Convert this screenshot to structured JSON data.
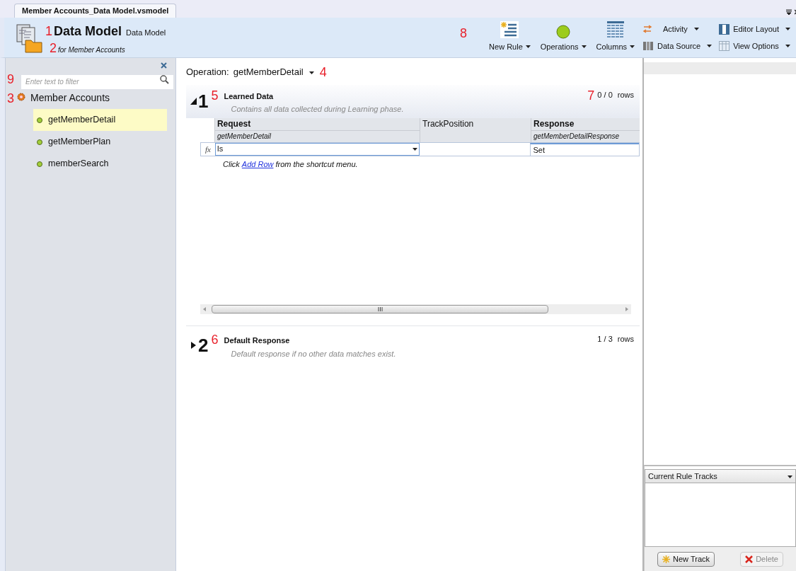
{
  "document_tab": {
    "title": "Member Accounts_Data Model.vsmodel",
    "selected": true
  },
  "header": {
    "title_callout": "1",
    "title": "Data Model",
    "subtitle": "Data Model",
    "for_callout": "2",
    "for_text": "for Member Accounts"
  },
  "toolbar": {
    "callout": "8",
    "large_buttons": [
      {
        "label": "New Rule",
        "kind": "new-rule"
      },
      {
        "label": "Operations",
        "kind": "operations"
      },
      {
        "label": "Columns",
        "kind": "columns"
      }
    ],
    "small_buttons": [
      {
        "label": "Activity",
        "kind": "activity"
      },
      {
        "label": "Editor Layout",
        "kind": "layout"
      },
      {
        "label": "Data Source",
        "kind": "data-source"
      },
      {
        "label": "View Options",
        "kind": "view-options"
      }
    ]
  },
  "sidebar": {
    "filter_callout": "9",
    "filter": {
      "placeholder": "Enter text to filter"
    },
    "tree": {
      "callout": "3",
      "label": "Member Accounts",
      "children": [
        {
          "label": "getMemberDetail",
          "selected": true
        },
        {
          "label": "getMemberPlan",
          "selected": false
        },
        {
          "label": "memberSearch",
          "selected": false
        }
      ]
    }
  },
  "operation": {
    "label": "Operation:",
    "value": "getMemberDetail",
    "callout": "4"
  },
  "sections": [
    {
      "number": "1",
      "callout": "5",
      "title": "Learned Data",
      "description": "Contains all data collected during Learning phase.",
      "count_callout": "7",
      "count": "0 / 0",
      "rows_label": "rows",
      "expanded": true,
      "table": {
        "row_marker": "fx",
        "columns": [
          {
            "title": "Request",
            "subtitle": "getMemberDetail",
            "bold": true
          },
          {
            "title": "TrackPosition",
            "bold": false
          },
          {
            "title": "Response",
            "subtitle": "getMemberDetailResponse",
            "bold": true
          }
        ],
        "cells": [
          {
            "kind": "dropdown",
            "value": "Is"
          },
          {
            "kind": "blank"
          },
          {
            "kind": "text",
            "value": "Set"
          }
        ],
        "hint": {
          "before": "Click",
          "link": "Add Row",
          "after": "from the shortcut menu."
        }
      }
    },
    {
      "number": "2",
      "callout": "6",
      "title": "Default Response",
      "description": "Default response if no other data matches exist.",
      "count": "1 / 3",
      "rows_label": "rows",
      "expanded": false
    }
  ],
  "right_panel": {
    "tracks_title": "Current Rule Tracks",
    "buttons": [
      {
        "label": "New Track",
        "kind": "new",
        "disabled": false
      },
      {
        "label": "Delete",
        "kind": "delete",
        "disabled": true
      }
    ]
  }
}
